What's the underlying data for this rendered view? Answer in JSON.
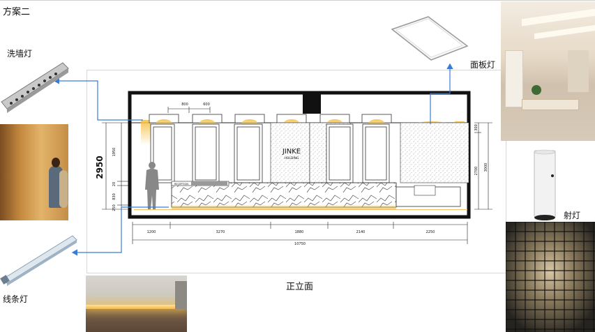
{
  "page": {
    "title": "方案二"
  },
  "labels": {
    "wall_washer": "洗墙灯",
    "panel_light": "面板灯",
    "spot_light": "射灯",
    "strip_light": "线条灯",
    "elevation": "正立面"
  },
  "drawing": {
    "height_main": "2950",
    "brand_line1": "JINKE",
    "brand_line2": "HOLDING",
    "reception": "RECEPTION",
    "bottom_dims": [
      "1200",
      "3270",
      "1880",
      "2140",
      "2250"
    ],
    "total_width": "10750",
    "top_dims": [
      "800",
      "600"
    ],
    "left_dims": [
      "1950",
      "20",
      "830",
      "250"
    ],
    "right_dims": [
      "300",
      "2700",
      "3000"
    ]
  },
  "colors": {
    "wall_line": "#111111",
    "light_glow": "#f2c45a",
    "arrow": "#3a7bd5"
  }
}
